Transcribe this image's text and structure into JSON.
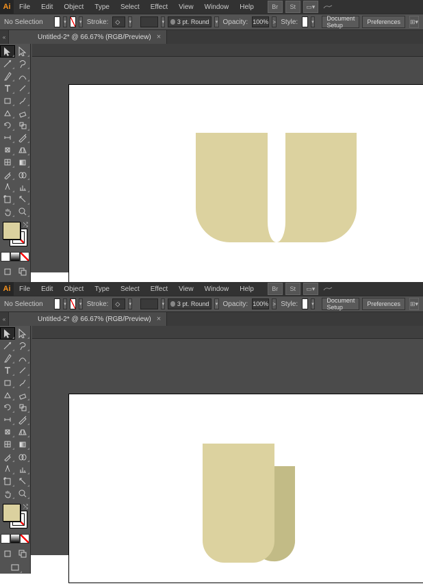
{
  "menu": [
    "File",
    "Edit",
    "Object",
    "Type",
    "Select",
    "Effect",
    "View",
    "Window",
    "Help"
  ],
  "optbar": {
    "selection_label": "No Selection",
    "stroke_label": "Stroke:",
    "brush_profile": "3 pt. Round",
    "opacity_label": "Opacity:",
    "opacity_value": "100%",
    "style_label": "Style:",
    "doc_setup": "Document Setup",
    "preferences": "Preferences"
  },
  "tab": {
    "title": "Untitled-2* @ 66.67% (RGB/Preview)"
  },
  "tools": {
    "fill_color": "#dbd19f",
    "shape_fill_1": "#dcd29f",
    "shape_fill_2a": "#dcd29f",
    "shape_fill_2b": "#c2bb86"
  }
}
